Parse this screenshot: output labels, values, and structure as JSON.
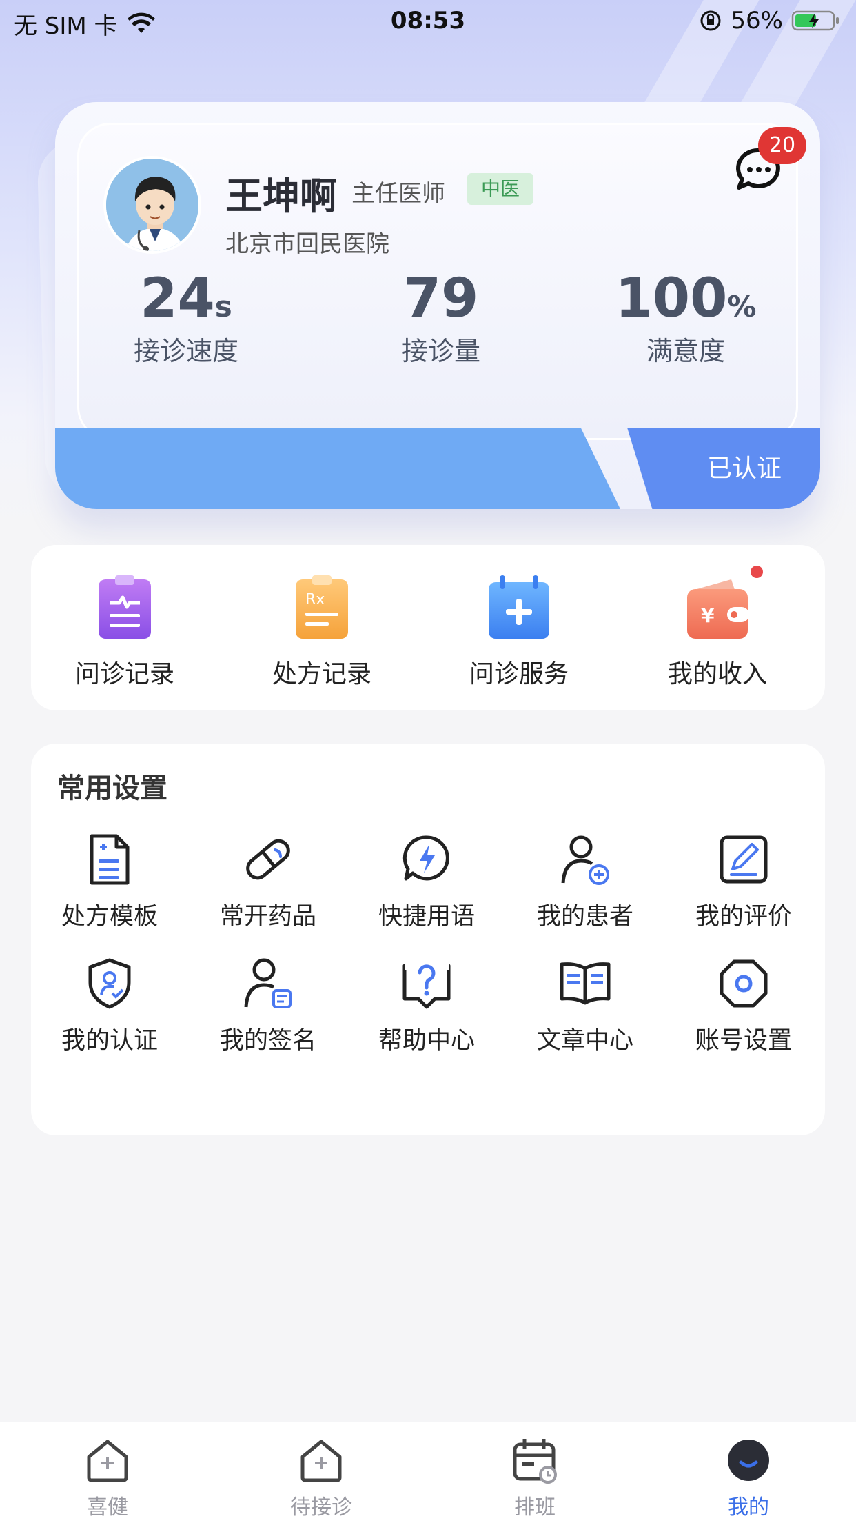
{
  "status_bar": {
    "carrier": "无 SIM 卡",
    "time": "08:53",
    "battery": "56%"
  },
  "profile": {
    "name": "王坤啊",
    "title": "主任医师",
    "tag": "中医",
    "hospital": "北京市回民医院",
    "message_badge": "20",
    "verified_label": "已认证",
    "stats": [
      {
        "value": "24",
        "unit": "s",
        "label": "接诊速度"
      },
      {
        "value": "79",
        "unit": "",
        "label": "接诊量"
      },
      {
        "value": "100",
        "unit": "%",
        "label": "满意度"
      }
    ]
  },
  "quick_menu": [
    {
      "label": "问诊记录",
      "icon": "clipboard-pulse-icon"
    },
    {
      "label": "处方记录",
      "icon": "prescription-rx-icon"
    },
    {
      "label": "问诊服务",
      "icon": "calendar-plus-icon"
    },
    {
      "label": "我的收入",
      "icon": "wallet-icon"
    }
  ],
  "settings": {
    "title": "常用设置",
    "items": [
      {
        "label": "处方模板",
        "icon": "document-plus-icon"
      },
      {
        "label": "常开药品",
        "icon": "pill-icon"
      },
      {
        "label": "快捷用语",
        "icon": "lightning-chat-icon"
      },
      {
        "label": "我的患者",
        "icon": "user-plus-icon"
      },
      {
        "label": "我的评价",
        "icon": "edit-review-icon"
      },
      {
        "label": "我的认证",
        "icon": "shield-user-icon"
      },
      {
        "label": "我的签名",
        "icon": "user-sign-icon"
      },
      {
        "label": "帮助中心",
        "icon": "help-chat-icon"
      },
      {
        "label": "文章中心",
        "icon": "open-book-icon"
      },
      {
        "label": "账号设置",
        "icon": "settings-octagon-icon"
      }
    ]
  },
  "tabbar": [
    {
      "label": "喜健",
      "icon": "home-plus-icon",
      "active": false
    },
    {
      "label": "待接诊",
      "icon": "home-plus-icon",
      "active": false
    },
    {
      "label": "排班",
      "icon": "calendar-clock-icon",
      "active": false
    },
    {
      "label": "我的",
      "icon": "profile-smile-icon",
      "active": true
    }
  ],
  "colors": {
    "accent": "#3b6fe8",
    "band_left": "#6faaf4",
    "band_right": "#5f8df2",
    "badge": "#e03634"
  }
}
